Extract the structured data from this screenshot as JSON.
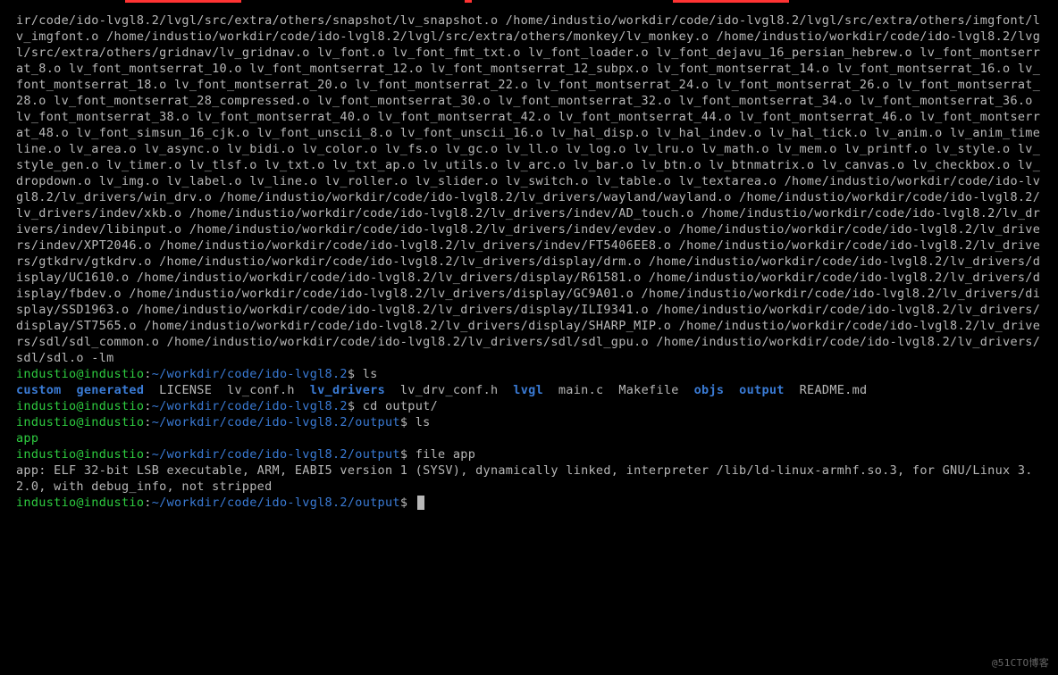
{
  "compile_output": "ir/code/ido-lvgl8.2/lvgl/src/extra/others/snapshot/lv_snapshot.o /home/industio/workdir/code/ido-lvgl8.2/lvgl/src/extra/others/imgfont/lv_imgfont.o /home/industio/workdir/code/ido-lvgl8.2/lvgl/src/extra/others/monkey/lv_monkey.o /home/industio/workdir/code/ido-lvgl8.2/lvgl/src/extra/others/gridnav/lv_gridnav.o lv_font.o lv_font_fmt_txt.o lv_font_loader.o lv_font_dejavu_16_persian_hebrew.o lv_font_montserrat_8.o lv_font_montserrat_10.o lv_font_montserrat_12.o lv_font_montserrat_12_subpx.o lv_font_montserrat_14.o lv_font_montserrat_16.o lv_font_montserrat_18.o lv_font_montserrat_20.o lv_font_montserrat_22.o lv_font_montserrat_24.o lv_font_montserrat_26.o lv_font_montserrat_28.o lv_font_montserrat_28_compressed.o lv_font_montserrat_30.o lv_font_montserrat_32.o lv_font_montserrat_34.o lv_font_montserrat_36.o lv_font_montserrat_38.o lv_font_montserrat_40.o lv_font_montserrat_42.o lv_font_montserrat_44.o lv_font_montserrat_46.o lv_font_montserrat_48.o lv_font_simsun_16_cjk.o lv_font_unscii_8.o lv_font_unscii_16.o lv_hal_disp.o lv_hal_indev.o lv_hal_tick.o lv_anim.o lv_anim_timeline.o lv_area.o lv_async.o lv_bidi.o lv_color.o lv_fs.o lv_gc.o lv_ll.o lv_log.o lv_lru.o lv_math.o lv_mem.o lv_printf.o lv_style.o lv_style_gen.o lv_timer.o lv_tlsf.o lv_txt.o lv_txt_ap.o lv_utils.o lv_arc.o lv_bar.o lv_btn.o lv_btnmatrix.o lv_canvas.o lv_checkbox.o lv_dropdown.o lv_img.o lv_label.o lv_line.o lv_roller.o lv_slider.o lv_switch.o lv_table.o lv_textarea.o /home/industio/workdir/code/ido-lvgl8.2/lv_drivers/win_drv.o /home/industio/workdir/code/ido-lvgl8.2/lv_drivers/wayland/wayland.o /home/industio/workdir/code/ido-lvgl8.2/lv_drivers/indev/xkb.o /home/industio/workdir/code/ido-lvgl8.2/lv_drivers/indev/AD_touch.o /home/industio/workdir/code/ido-lvgl8.2/lv_drivers/indev/libinput.o /home/industio/workdir/code/ido-lvgl8.2/lv_drivers/indev/evdev.o /home/industio/workdir/code/ido-lvgl8.2/lv_drivers/indev/XPT2046.o /home/industio/workdir/code/ido-lvgl8.2/lv_drivers/indev/FT5406EE8.o /home/industio/workdir/code/ido-lvgl8.2/lv_drivers/gtkdrv/gtkdrv.o /home/industio/workdir/code/ido-lvgl8.2/lv_drivers/display/drm.o /home/industio/workdir/code/ido-lvgl8.2/lv_drivers/display/UC1610.o /home/industio/workdir/code/ido-lvgl8.2/lv_drivers/display/R61581.o /home/industio/workdir/code/ido-lvgl8.2/lv_drivers/display/fbdev.o /home/industio/workdir/code/ido-lvgl8.2/lv_drivers/display/GC9A01.o /home/industio/workdir/code/ido-lvgl8.2/lv_drivers/display/SSD1963.o /home/industio/workdir/code/ido-lvgl8.2/lv_drivers/display/ILI9341.o /home/industio/workdir/code/ido-lvgl8.2/lv_drivers/display/ST7565.o /home/industio/workdir/code/ido-lvgl8.2/lv_drivers/display/SHARP_MIP.o /home/industio/workdir/code/ido-lvgl8.2/lv_drivers/sdl/sdl_common.o /home/industio/workdir/code/ido-lvgl8.2/lv_drivers/sdl/sdl_gpu.o /home/industio/workdir/code/ido-lvgl8.2/lv_drivers/sdl/sdl.o -lm",
  "prompts": {
    "p1_user": "industio@industio",
    "p1_path": "~/workdir/code/ido-lvgl8.2",
    "p1_cmd": "ls",
    "p2_user": "industio@industio",
    "p2_path": "~/workdir/code/ido-lvgl8.2",
    "p2_cmd": "cd output/",
    "p3_user": "industio@industio",
    "p3_path": "~/workdir/code/ido-lvgl8.2/output",
    "p3_cmd": "ls",
    "p4_user": "industio@industio",
    "p4_path": "~/workdir/code/ido-lvgl8.2/output",
    "p4_cmd": "file app",
    "p5_user": "industio@industio",
    "p5_path": "~/workdir/code/ido-lvgl8.2/output",
    "sep": ":",
    "dollar": "$"
  },
  "ls1": {
    "custom": "custom",
    "generated": "generated",
    "license": "LICENSE",
    "lv_conf": "lv_conf.h",
    "lv_drivers": "lv_drivers",
    "lv_drv_conf": "lv_drv_conf.h",
    "lvgl": "lvgl",
    "main": "main.c",
    "makefile": "Makefile",
    "objs": "objs",
    "output": "output",
    "readme": "README.md"
  },
  "ls2": {
    "app": "app"
  },
  "file_output": "app: ELF 32-bit LSB executable, ARM, EABI5 version 1 (SYSV), dynamically linked, interpreter /lib/ld-linux-armhf.so.3, for GNU/Linux 3.2.0, with debug_info, not stripped",
  "watermark": "@51CTO博客"
}
